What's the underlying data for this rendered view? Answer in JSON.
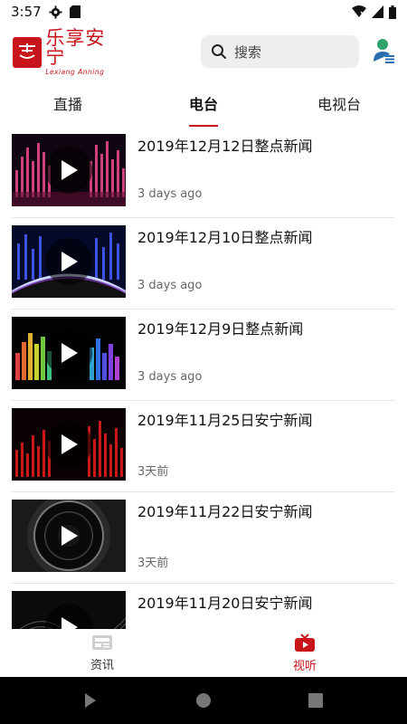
{
  "status_bar": {
    "time": "3:57"
  },
  "header": {
    "logo_text_cn": "乐享安宁",
    "logo_text_en": "Lexiang Anning",
    "search_placeholder": "搜索"
  },
  "tabs": [
    {
      "label": "直播"
    },
    {
      "label": "电台"
    },
    {
      "label": "电视台"
    }
  ],
  "active_tab": "电台",
  "items": [
    {
      "title": "2019年12月12日整点新闻",
      "time": "3 days ago",
      "thumb": "pink-equalizer"
    },
    {
      "title": "2019年12月10日整点新闻",
      "time": "3 days ago",
      "thumb": "blue-arc-glow"
    },
    {
      "title": "2019年12月9日整点新闻",
      "time": "3 days ago",
      "thumb": "rainbow-equalizer"
    },
    {
      "title": "2019年11月25日安宁新闻",
      "time": "3天前",
      "thumb": "red-equalizer"
    },
    {
      "title": "2019年11月22日安宁新闻",
      "time": "3天前",
      "thumb": "speaker"
    },
    {
      "title": "2019年11月20日安宁新闻",
      "time": "",
      "thumb": "dark-wave"
    }
  ],
  "bottom_nav": [
    {
      "label": "资讯",
      "icon": "news-icon"
    },
    {
      "label": "视听",
      "icon": "tv-icon"
    }
  ],
  "colors": {
    "accent": "#c8151b",
    "active_nav": "#c8151b"
  }
}
